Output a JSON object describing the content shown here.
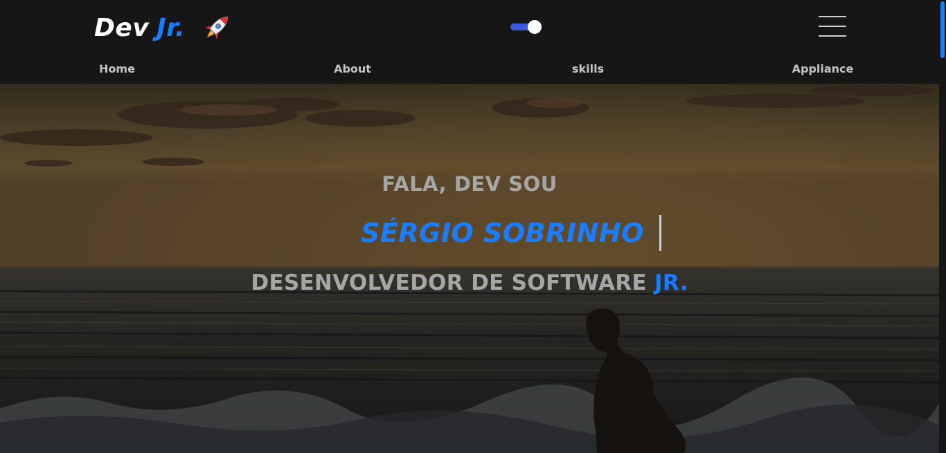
{
  "header": {
    "logo_dev": "Dev",
    "logo_jr": "Jr.",
    "logo_icon": "rocket-icon",
    "theme_toggle_state": "on",
    "menu_icon": "hamburger-menu-icon"
  },
  "nav": {
    "items": [
      {
        "label": "Home"
      },
      {
        "label": "About"
      },
      {
        "label": "skills"
      },
      {
        "label": "Appliance"
      }
    ]
  },
  "hero": {
    "greeting": "FALA, DEV SOU",
    "name": "SÉRGIO SOBRINHO",
    "role_main": "DESENVOLVEDOR DE SOFTWARE",
    "role_accent": "JR."
  },
  "colors": {
    "accent": "#1a7dff",
    "toggle_track": "#3b5bdb",
    "header_bg": "#161616",
    "muted_text": "#a6a6a6"
  }
}
